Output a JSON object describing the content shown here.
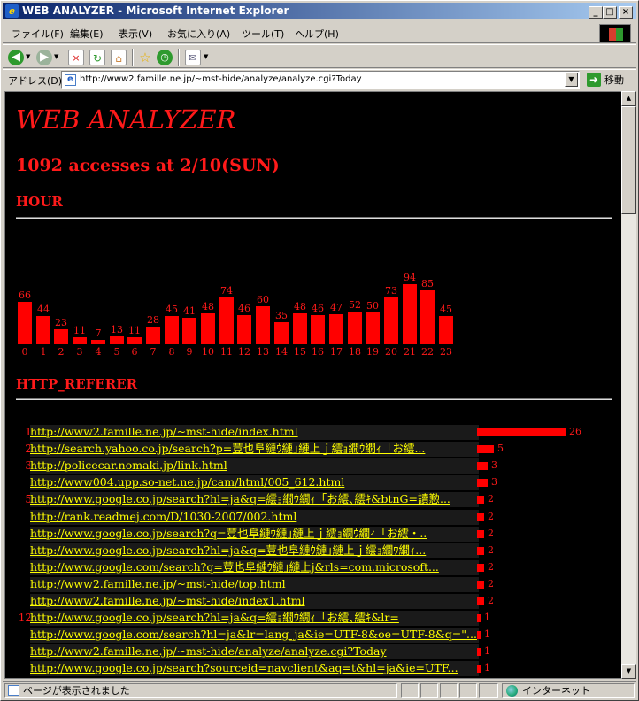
{
  "window": {
    "title": "WEB ANALYZER - Microsoft Internet Explorer"
  },
  "menu": [
    "ファイル(F)",
    "編集(E)",
    "表示(V)",
    "お気に入り(A)",
    "ツール(T)",
    "ヘルプ(H)"
  ],
  "address": {
    "label": "アドレス(D)",
    "url": "http://www2.famille.ne.jp/~mst-hide/analyze/analyze.cgi?Today",
    "go_label": "移動"
  },
  "status": {
    "text": "ページが表示されました",
    "zone": "インターネット"
  },
  "page": {
    "title": "WEB ANALYZER",
    "subtitle": "1092 accesses at 2/10(SUN)",
    "hour_heading": "HOUR",
    "referer_heading": "HTTP_REFERER"
  },
  "chart_data": {
    "type": "bar",
    "categories": [
      "0",
      "1",
      "2",
      "3",
      "4",
      "5",
      "6",
      "7",
      "8",
      "9",
      "10",
      "11",
      "12",
      "13",
      "14",
      "15",
      "16",
      "17",
      "18",
      "19",
      "20",
      "21",
      "22",
      "23"
    ],
    "values": [
      66,
      44,
      23,
      11,
      7,
      13,
      11,
      28,
      45,
      41,
      48,
      74,
      46,
      60,
      35,
      48,
      46,
      47,
      52,
      50,
      73,
      94,
      85,
      45
    ],
    "bar_color": "#ff0000",
    "text_color": "#ff1a1a"
  },
  "referers": [
    {
      "rank": "1",
      "url": "http://www2.famille.ne.jp/~mst-hide/index.html",
      "count": 26
    },
    {
      "rank": "2",
      "url": "http://search.yahoo.co.jp/search?p=荳也阜縺ｳ縺｣縺上ｊ繧ｮ繝ｳ繝ｨ「お繧...",
      "count": 5
    },
    {
      "rank": "3",
      "url": "http://policecar.nomaki.jp/link.html",
      "count": 3
    },
    {
      "rank": "",
      "url": "http://www004.upp.so-net.ne.jp/cam/html/005_612.html",
      "count": 3
    },
    {
      "rank": "5",
      "url": "http://www.google.co.jp/search?hl=ja&q=繧ｮ繝ｳ繝ｨ「お繧､繧ｷ&btnG=讀懃...",
      "count": 2
    },
    {
      "rank": "",
      "url": "http://rank.readmej.com/D/1030-2007/002.html",
      "count": 2
    },
    {
      "rank": "",
      "url": "http://www.google.co.jp/search?q=荳也阜縺ｳ縺｣縺上ｊ繧ｮ繝ｳ繝ｨ「お繧・..",
      "count": 2
    },
    {
      "rank": "",
      "url": "http://www.google.co.jp/search?hl=ja&q=荳也阜縺ｳ縺｣縺上ｊ繧ｮ繝ｳ繝ｨ...",
      "count": 2
    },
    {
      "rank": "",
      "url": "http://www.google.com/search?q=荳也阜縺ｳ縺｣縺上j&rls=com.microsoft...",
      "count": 2
    },
    {
      "rank": "",
      "url": "http://www2.famille.ne.jp/~mst-hide/top.html",
      "count": 2
    },
    {
      "rank": "",
      "url": "http://www2.famille.ne.jp/~mst-hide/index1.html",
      "count": 2
    },
    {
      "rank": "12",
      "url": "http://www.google.co.jp/search?hl=ja&q=繧ｮ繝ｳ繝ｨ「お繧､繧ｷ&lr=",
      "count": 1
    },
    {
      "rank": "",
      "url": "http://www.google.com/search?hl=ja&lr=lang_ja&ie=UTF-8&oe=UTF-8&q=\"...",
      "count": 1
    },
    {
      "rank": "",
      "url": "http://www2.famille.ne.jp/~mst-hide/analyze/analyze.cgi?Today",
      "count": 1
    },
    {
      "rank": "",
      "url": "http://www.google.co.jp/search?sourceid=navclient&aq=t&hl=ja&ie=UTF...",
      "count": 1
    }
  ]
}
